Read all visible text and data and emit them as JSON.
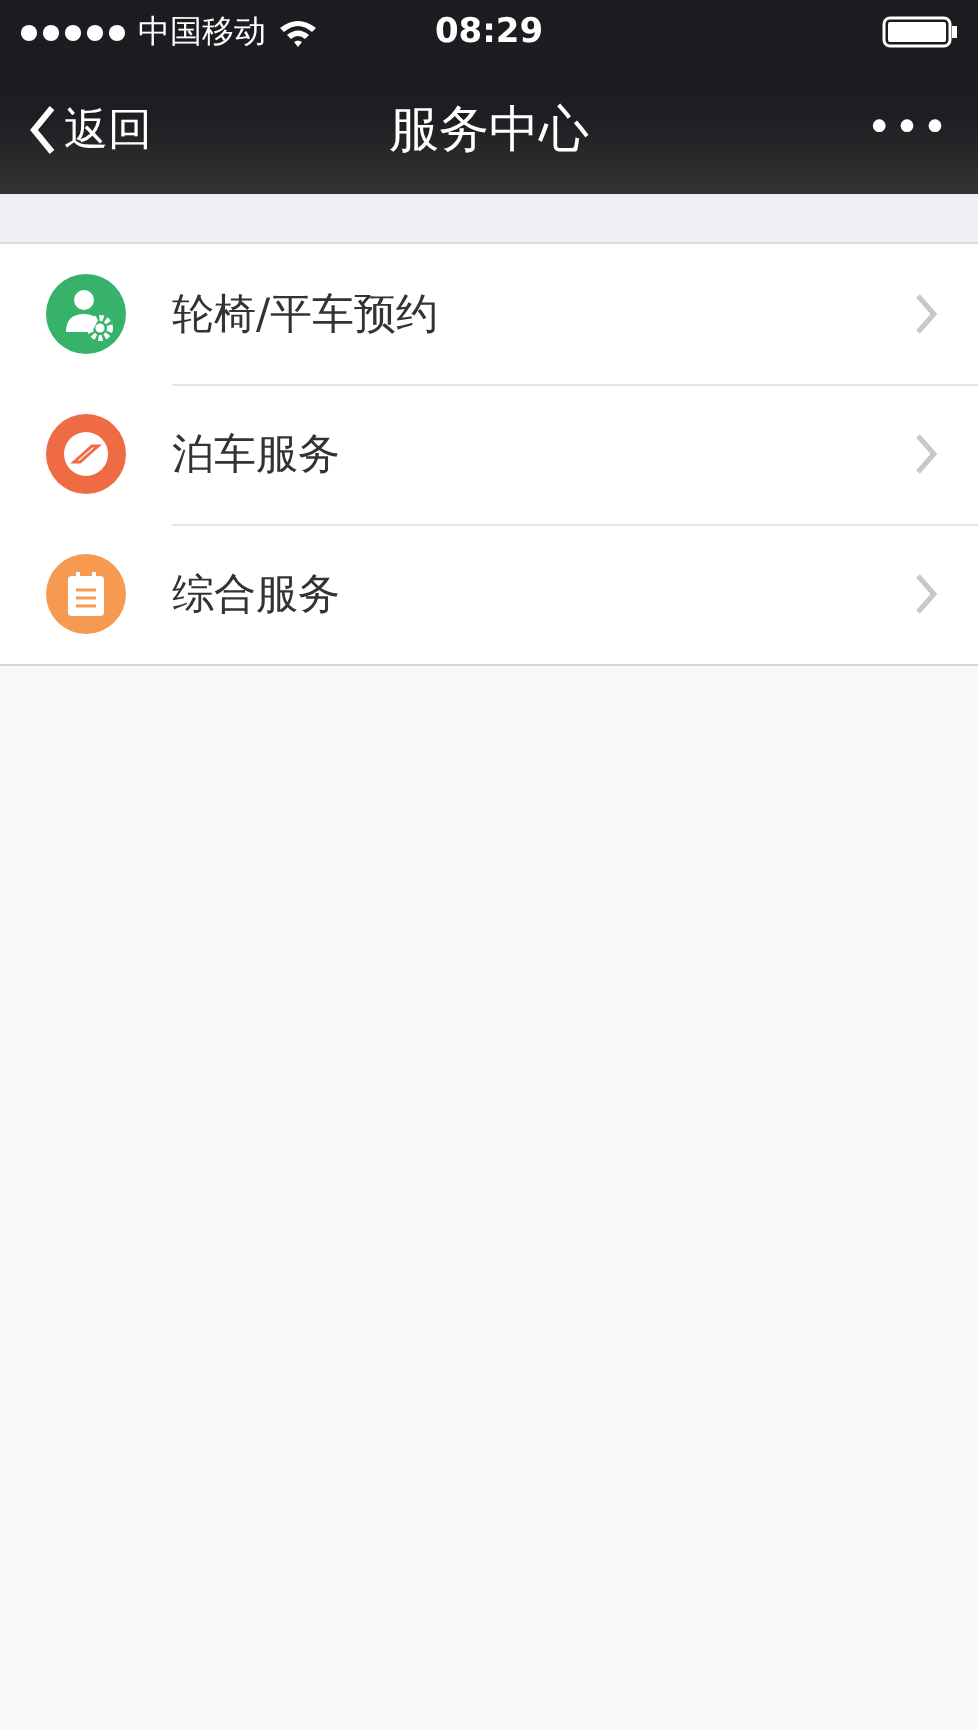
{
  "status_bar": {
    "carrier": "中国移动",
    "time": "08:29"
  },
  "nav_bar": {
    "back": "返回",
    "title": "服务中心",
    "more": "•••"
  },
  "items": [
    {
      "label": "轮椅/平车预约",
      "kind": "person",
      "color": "#36b26b"
    },
    {
      "label": "泊车服务",
      "kind": "compass",
      "color": "#ee6b44"
    },
    {
      "label": "综合服务",
      "kind": "notepad",
      "color": "#f59a50"
    }
  ]
}
